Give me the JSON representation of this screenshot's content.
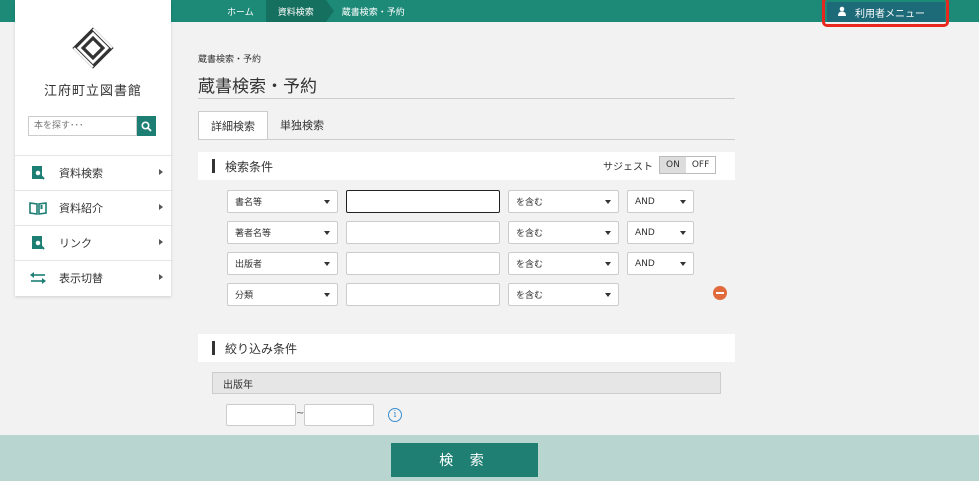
{
  "breadcrumbs": [
    "ホーム",
    "資料検索",
    "蔵書検索・予約"
  ],
  "user_menu": {
    "label": "利用者メニュー",
    "icon": "user-icon"
  },
  "sidebar": {
    "library_name": "江府町立図書館",
    "search_placeholder": "本を探す･･･",
    "items": [
      {
        "label": "資料検索",
        "icon": "book-search-icon"
      },
      {
        "label": "資料紹介",
        "icon": "open-book-icon"
      },
      {
        "label": "リンク",
        "icon": "link-search-icon"
      },
      {
        "label": "表示切替",
        "icon": "swap-arrows-icon"
      }
    ]
  },
  "main": {
    "small_breadcrumb": "蔵書検索・予約",
    "title": "蔵書検索・予約",
    "tabs": [
      {
        "label": "詳細検索",
        "active": true
      },
      {
        "label": "単独検索",
        "active": false
      }
    ],
    "conditions": {
      "heading": "検索条件",
      "suggest_label": "サジェスト",
      "toggle_on": "ON",
      "toggle_off": "OFF",
      "rows": [
        {
          "field": "書名等",
          "match": "を含む",
          "op": "AND"
        },
        {
          "field": "著者名等",
          "match": "を含む",
          "op": "AND"
        },
        {
          "field": "出版者",
          "match": "を含む",
          "op": "AND"
        },
        {
          "field": "分類",
          "match": "を含む",
          "op": ""
        }
      ]
    },
    "filters": {
      "heading": "絞り込み条件",
      "year_label": "出版年",
      "range_sep": "~",
      "info_glyph": "i"
    }
  },
  "search_button": "検 索",
  "colors": {
    "brand": "#1d8a78",
    "highlight": "#e8281e",
    "remove": "#e06a3b"
  }
}
